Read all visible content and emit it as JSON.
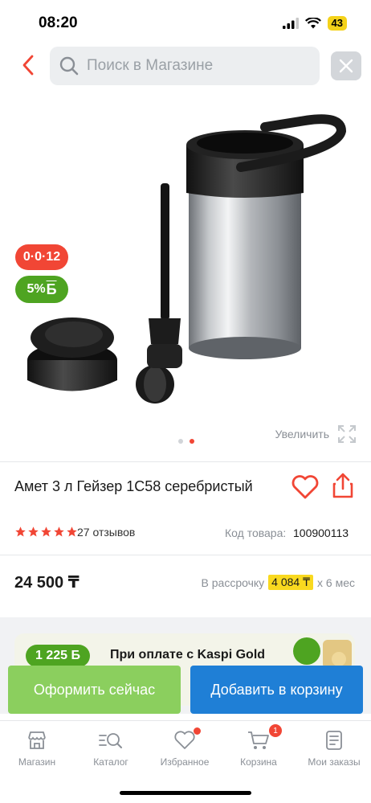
{
  "status_bar": {
    "time": "08:20",
    "battery": "43"
  },
  "search": {
    "placeholder": "Поиск в Магазине"
  },
  "badges": {
    "installment": "0·0·12",
    "bonus_percent": "5%",
    "bonus_symbol": "Б"
  },
  "gallery": {
    "zoom_label": "Увеличить",
    "image_count": 2,
    "active_image": 2
  },
  "product": {
    "title": "Амет 3 л Гейзер 1С58 серебристый",
    "rating": 5,
    "reviews": "27 отзывов",
    "sku_label": "Код товара:",
    "sku": "100900113",
    "price": "24 500 ₸",
    "installment_prefix": "В рассрочку",
    "installment_amount": "4 084 ₸",
    "installment_suffix": "x 6 мес"
  },
  "kaspi_gold": {
    "bonus": "1 225 Б",
    "text": "При оплате с Kaspi Gold"
  },
  "actions": {
    "order_now": "Оформить сейчас",
    "add_to_cart": "Добавить в корзину"
  },
  "tabs": [
    {
      "label": "Магазин",
      "icon": "store-icon"
    },
    {
      "label": "Каталог",
      "icon": "catalog-search-icon"
    },
    {
      "label": "Избранное",
      "icon": "heart-icon"
    },
    {
      "label": "Корзина",
      "icon": "cart-icon",
      "badge": "1"
    },
    {
      "label": "Мои заказы",
      "icon": "orders-icon"
    }
  ],
  "colors": {
    "accent_red": "#f14635",
    "green": "#4ea421",
    "blue": "#1f7fd6",
    "yellow": "#f9d91f"
  }
}
